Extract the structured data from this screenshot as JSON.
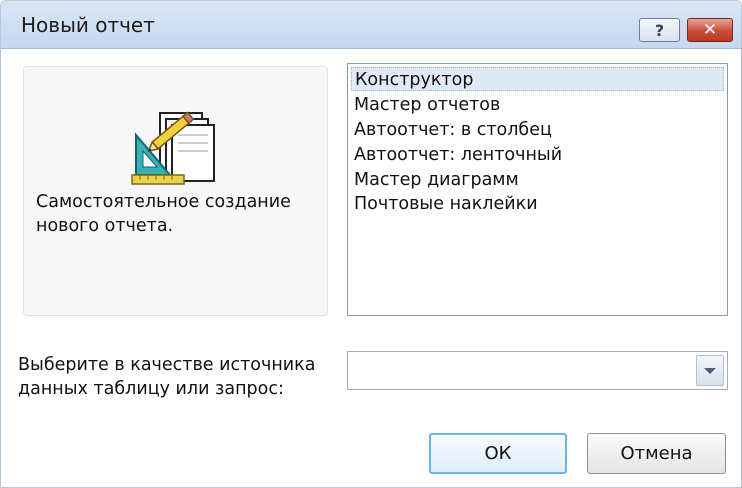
{
  "window": {
    "title": "Новый отчет",
    "help_label": "?",
    "close_label": "✕"
  },
  "preview": {
    "icon": "report-design-icon",
    "description": "Самостоятельное создание нового отчета."
  },
  "wizards": {
    "items": [
      "Конструктор",
      "Мастер отчетов",
      "Автоотчет: в столбец",
      "Автоотчет: ленточный",
      "Мастер диаграмм",
      "Почтовые наклейки"
    ],
    "selected": "Конструктор"
  },
  "source": {
    "label": "Выберите в качестве источника данных таблицу или запрос:",
    "value": ""
  },
  "buttons": {
    "ok": "ОК",
    "cancel": "Отмена"
  },
  "colors": {
    "titlebar": "#c6d8ef",
    "close": "#c94c37",
    "selection": "#dfeaf6",
    "ok_border": "#6fb4e0"
  }
}
